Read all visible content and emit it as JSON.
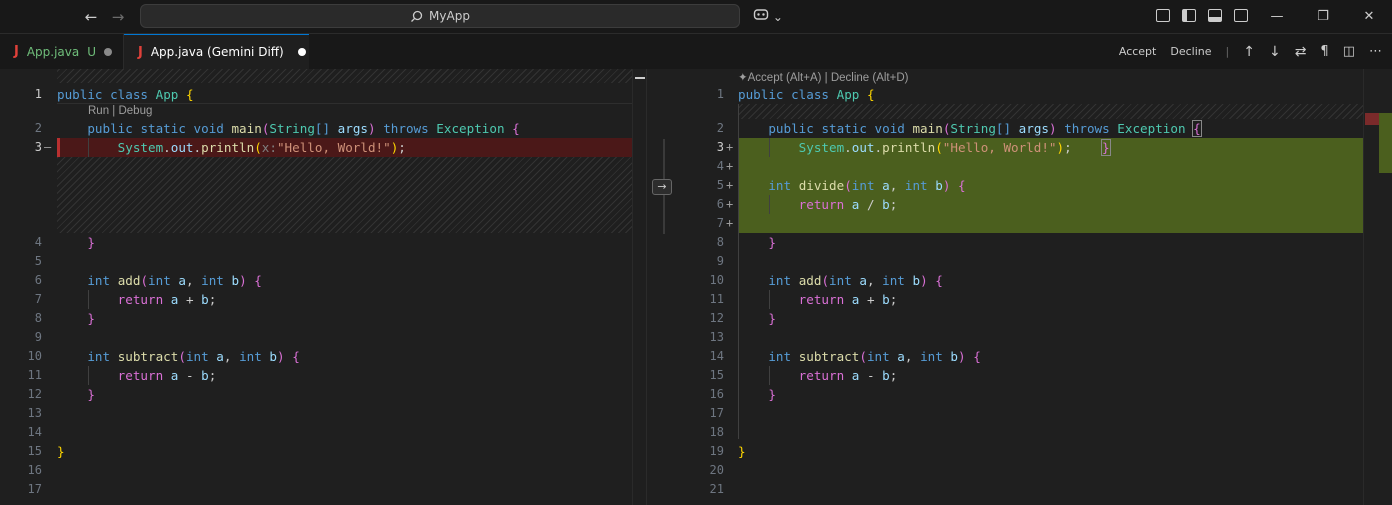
{
  "titlebar": {
    "search_text": "MyApp",
    "back_icon": "←",
    "forward_icon": "→",
    "copilot_icon": "copilot-icon",
    "window_controls": {
      "minimize": "—",
      "restore": "❐",
      "close": "✕"
    }
  },
  "tabs": [
    {
      "label": "App.java",
      "status": "U",
      "icon": "J",
      "color": "#6fbd7a"
    },
    {
      "label": "App.java (Gemini Diff)",
      "icon": "J",
      "color": "#ffffff"
    }
  ],
  "tab_actions": {
    "accept": "Accept",
    "decline": "Decline",
    "separator": "|"
  },
  "diff_hint": "✦Accept (Alt+A) | Decline (Alt+D)",
  "codelens": "Run | Debug",
  "colors": {
    "removed_bg": "#4b1818",
    "added_bg": "#4b5f1e",
    "accent": "#0078d4"
  },
  "left_lines": [
    "1",
    "2",
    "3",
    "4",
    "5",
    "6",
    "7",
    "8",
    "9",
    "10",
    "11",
    "12",
    "13",
    "14",
    "15",
    "16",
    "17"
  ],
  "right_lines": [
    "1",
    "2",
    "3",
    "4",
    "5",
    "6",
    "7",
    "8",
    "9",
    "10",
    "11",
    "12",
    "13",
    "14",
    "15",
    "16",
    "17",
    "18",
    "19",
    "20",
    "21"
  ]
}
